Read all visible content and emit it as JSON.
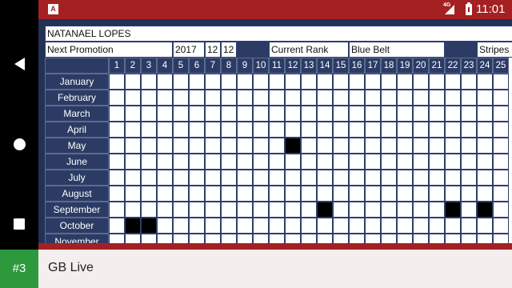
{
  "status_bar": {
    "app_icon_letter": "A",
    "network_label": "4G",
    "time": "11:01",
    "icons": [
      "signal-icon",
      "battery-icon"
    ]
  },
  "nav_bar": {
    "icons": [
      "back-icon",
      "home-icon",
      "recents-icon"
    ]
  },
  "sheet": {
    "student_name": "NATANAEL LOPES",
    "next_promotion_label": "Next Promotion",
    "year": "2017",
    "month_value": "12",
    "day_value": "12",
    "current_rank_label": "Current Rank",
    "rank_value": "Blue Belt",
    "stripes_label": "Stripes",
    "days": [
      "1",
      "2",
      "3",
      "4",
      "5",
      "6",
      "7",
      "8",
      "9",
      "10",
      "11",
      "12",
      "13",
      "14",
      "15",
      "16",
      "17",
      "18",
      "19",
      "20",
      "21",
      "22",
      "23",
      "24",
      "25"
    ],
    "months": [
      "January",
      "February",
      "March",
      "April",
      "May",
      "June",
      "July",
      "August",
      "September",
      "October",
      "November"
    ],
    "attendance_marks": [
      {
        "month": "May",
        "days": [
          12
        ]
      },
      {
        "month": "September",
        "days": [
          14,
          22,
          24
        ]
      },
      {
        "month": "October",
        "days": [
          2,
          3
        ]
      }
    ]
  },
  "overlay": {
    "badge": "#3",
    "app_name": "GB Live"
  },
  "colors": {
    "status_bar": "#a52022",
    "sheet_navy": "#2b3b64",
    "badge_green": "#2c9a3c"
  }
}
